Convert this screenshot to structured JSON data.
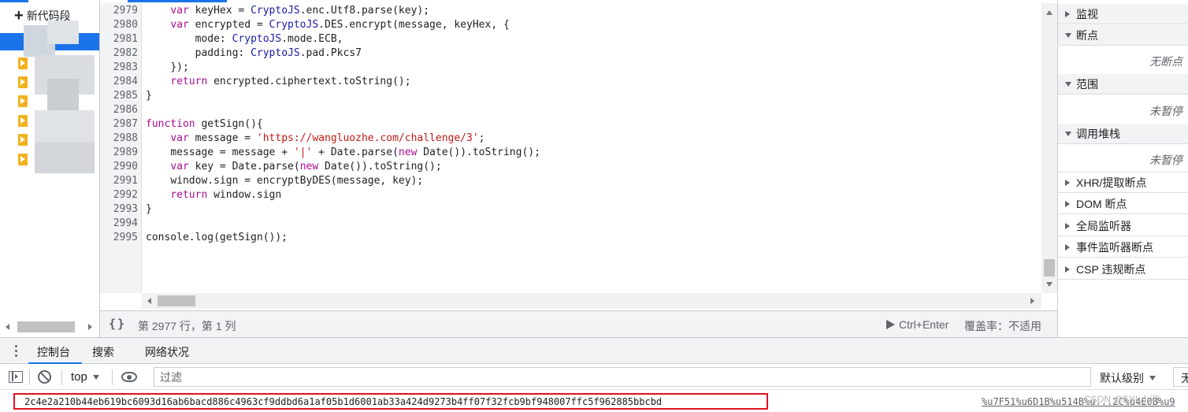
{
  "snippets": {
    "new_label": "新代码段",
    "items_count_visible": 6
  },
  "editor": {
    "lines": [
      {
        "n": "2979",
        "indent": "    ",
        "tokens": [
          [
            "kw",
            "var "
          ],
          [
            "plain",
            "keyHex = "
          ],
          [
            "sym",
            "CryptoJS"
          ],
          [
            "plain",
            ".enc.Utf8.parse(key);"
          ]
        ]
      },
      {
        "n": "2980",
        "indent": "    ",
        "tokens": [
          [
            "kw",
            "var "
          ],
          [
            "plain",
            "encrypted = "
          ],
          [
            "sym",
            "CryptoJS"
          ],
          [
            "plain",
            ".DES.encrypt(message, keyHex, {"
          ]
        ]
      },
      {
        "n": "2981",
        "indent": "        ",
        "tokens": [
          [
            "plain",
            "mode: "
          ],
          [
            "sym",
            "CryptoJS"
          ],
          [
            "plain",
            ".mode.ECB,"
          ]
        ]
      },
      {
        "n": "2982",
        "indent": "        ",
        "tokens": [
          [
            "plain",
            "padding: "
          ],
          [
            "sym",
            "CryptoJS"
          ],
          [
            "plain",
            ".pad.Pkcs7"
          ]
        ]
      },
      {
        "n": "2983",
        "indent": "    ",
        "tokens": [
          [
            "plain",
            "});"
          ]
        ]
      },
      {
        "n": "2984",
        "indent": "    ",
        "tokens": [
          [
            "kw",
            "return "
          ],
          [
            "plain",
            "encrypted.ciphertext.toString();"
          ]
        ]
      },
      {
        "n": "2985",
        "indent": "",
        "tokens": [
          [
            "plain",
            "}"
          ]
        ]
      },
      {
        "n": "2986",
        "indent": "",
        "tokens": []
      },
      {
        "n": "2987",
        "indent": "",
        "tokens": [
          [
            "kw",
            "function "
          ],
          [
            "plain",
            "getSign(){"
          ]
        ]
      },
      {
        "n": "2988",
        "indent": "    ",
        "tokens": [
          [
            "kw",
            "var "
          ],
          [
            "plain",
            "message = "
          ],
          [
            "str",
            "'https://wangluozhe.com/challenge/3'"
          ],
          [
            "plain",
            ";"
          ]
        ]
      },
      {
        "n": "2989",
        "indent": "    ",
        "tokens": [
          [
            "plain",
            "message = message + "
          ],
          [
            "str",
            "'|'"
          ],
          [
            "plain",
            " + Date.parse("
          ],
          [
            "kw",
            "new "
          ],
          [
            "plain",
            "Date()).toString();"
          ]
        ]
      },
      {
        "n": "2990",
        "indent": "    ",
        "tokens": [
          [
            "kw",
            "var "
          ],
          [
            "plain",
            "key = Date.parse("
          ],
          [
            "kw",
            "new "
          ],
          [
            "plain",
            "Date()).toString();"
          ]
        ]
      },
      {
        "n": "2991",
        "indent": "    ",
        "tokens": [
          [
            "plain",
            "window.sign = encryptByDES(message, key);"
          ]
        ]
      },
      {
        "n": "2992",
        "indent": "    ",
        "tokens": [
          [
            "kw",
            "return "
          ],
          [
            "plain",
            "window.sign"
          ]
        ]
      },
      {
        "n": "2993",
        "indent": "",
        "tokens": [
          [
            "plain",
            "}"
          ]
        ]
      },
      {
        "n": "2994",
        "indent": "",
        "tokens": []
      },
      {
        "n": "2995",
        "indent": "",
        "tokens": [
          [
            "plain",
            "console.log(getSign());"
          ]
        ]
      }
    ]
  },
  "statusbar": {
    "format_label": "{}",
    "cursor_position": "第 2977 行，第 1 列",
    "run_label": "Ctrl+Enter",
    "coverage": "覆盖率：不适用"
  },
  "debugger": {
    "watch": "监视",
    "breakpoints": "断点",
    "no_breakpoints": "无断点",
    "scope": "范围",
    "not_paused_1": "未暂停",
    "call_stack": "调用堆栈",
    "not_paused_2": "未暂停",
    "xhr": "XHR/提取断点",
    "dom": "DOM 断点",
    "global": "全局监听器",
    "event": "事件监听器断点",
    "csp": "CSP 违规断点"
  },
  "drawer": {
    "tabs": [
      "控制台",
      "搜索",
      "网络状况"
    ]
  },
  "console": {
    "context": "top",
    "filter_placeholder": "过滤",
    "levels": "默认级别",
    "settings_stub": "无",
    "output": "2c4e2a210b44eb619bc6093d16ab6bacd886c4963cf9ddbd6a1af05b1d6001ab33a424d9273b4ff07f32fcb9bf948007ffc5f962885bbcbd",
    "source_link": "%u7F51%u6D1B%u514B%u...2C%u4E0B%u9",
    "watermark": "CSDN @FYL小洲"
  },
  "colors": {
    "accent": "#1a73e8",
    "keyword": "#aa0d91",
    "identifier": "#1a1aa6",
    "string": "#c41a16",
    "highlight_box": "#e1121f"
  }
}
